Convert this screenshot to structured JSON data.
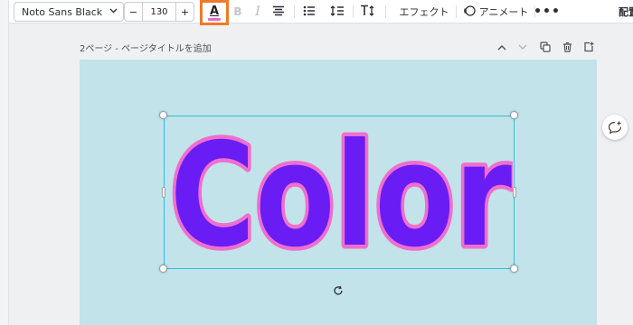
{
  "toolbar": {
    "font_name": "Noto Sans Black",
    "size_minus": "−",
    "font_size": "130",
    "size_plus": "+",
    "text_color_letter": "A",
    "text_color_swatch": "#e968c9",
    "highlight_color": "#ee7a2a",
    "bold_label": "B",
    "italic_label": "I",
    "effect_label": "エフェクト",
    "animate_label": "アニメート",
    "more_label": "•••",
    "overflow_label": "配置"
  },
  "page": {
    "title": "2ページ - ページタイトルを追加",
    "background": "#c2e3ea"
  },
  "canvas_text": {
    "content": "Color",
    "fill_color": "#6a1cf5",
    "stroke_color": "#ef6fce"
  },
  "icons": {
    "chevron_up": "chevron-up-icon",
    "chevron_down": "chevron-down-icon",
    "duplicate": "duplicate-page-icon",
    "delete": "trash-icon",
    "add_page": "add-page-icon",
    "rotate": "rotate-icon",
    "comment": "add-comment-icon"
  }
}
